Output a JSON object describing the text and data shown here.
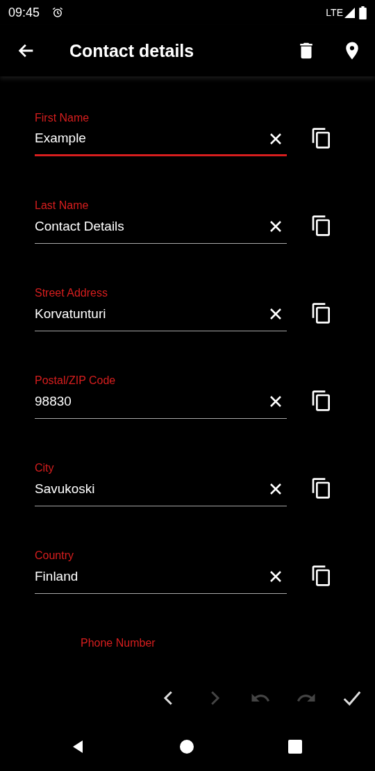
{
  "status_bar": {
    "time": "09:45",
    "network": "LTE"
  },
  "app_bar": {
    "title": "Contact details"
  },
  "fields": [
    {
      "label": "First Name",
      "value": "Example",
      "focused": true
    },
    {
      "label": "Last Name",
      "value": "Contact Details",
      "focused": false
    },
    {
      "label": "Street Address",
      "value": "Korvatunturi",
      "focused": false
    },
    {
      "label": "Postal/ZIP Code",
      "value": "98830",
      "focused": false
    },
    {
      "label": "City",
      "value": "Savukoski",
      "focused": false
    },
    {
      "label": "Country",
      "value": "Finland",
      "focused": false
    }
  ],
  "partial_field": {
    "label": "Phone Number"
  },
  "toolbar": [
    {
      "kind": "previous",
      "disabled": false
    },
    {
      "kind": "next",
      "disabled": true
    },
    {
      "kind": "undo",
      "disabled": true
    },
    {
      "kind": "redo",
      "disabled": true
    },
    {
      "kind": "done",
      "disabled": false
    }
  ]
}
